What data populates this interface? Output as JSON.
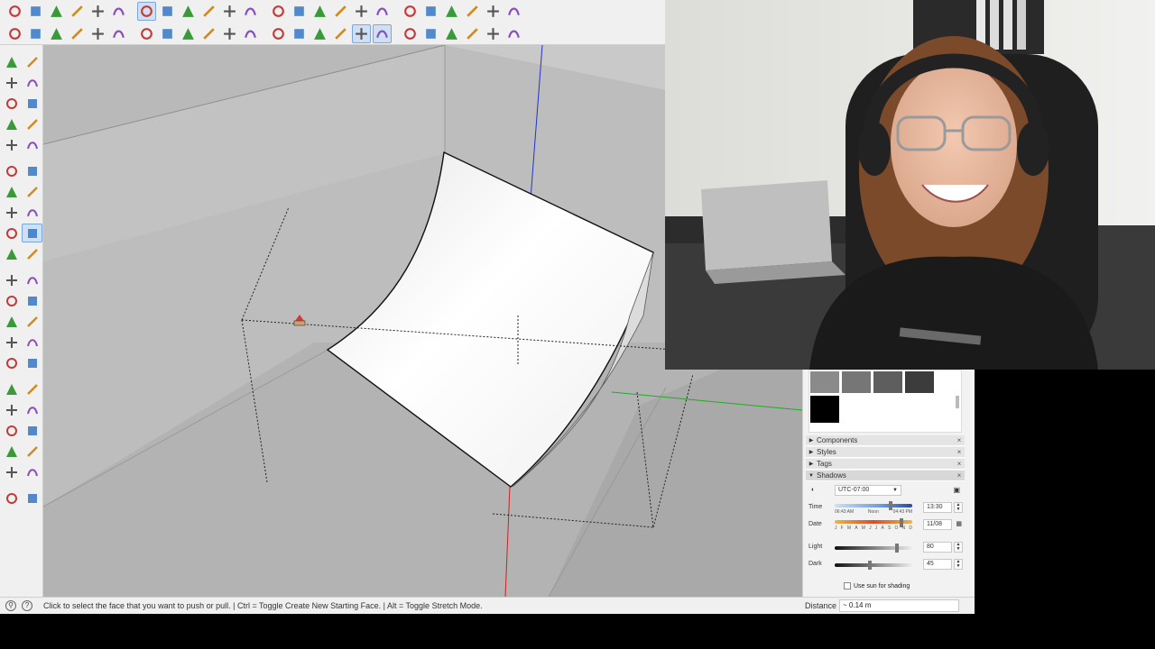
{
  "app": {
    "toolbar_row1_icons": [
      "search-icon",
      "select-icon",
      "eraser-icon",
      "pencil-icon",
      "arc-icon",
      "rectangle-icon",
      "push-pull-icon",
      "follow-me-icon",
      "move-icon",
      "rotate-icon",
      "scale-icon",
      "tape-measure-icon",
      "text-icon",
      "paint-bucket-icon",
      "orbit-icon",
      "zoom-icon",
      "zoom-extents-icon",
      "sandbox-icon",
      "walk-icon",
      "position-camera-icon",
      "look-around-icon",
      "section-plane-icon",
      "display-section-icon",
      "outliner-icon"
    ],
    "toolbar_row2_icons": [
      "component-icon",
      "group-icon",
      "home-icon",
      "warehouse-icon",
      "share-icon",
      "upload-icon",
      "solid-union-icon",
      "solid-subtract-icon",
      "solid-intersect-icon",
      "solid-trim-icon",
      "solid-split-icon",
      "solid-outer-icon",
      "xray-icon",
      "back-edges-icon",
      "wireframe-icon",
      "hidden-line-icon",
      "shaded-icon",
      "textured-icon",
      "iso-view-icon",
      "top-view-icon",
      "front-view-icon",
      "right-view-icon",
      "back-view-icon",
      "left-view-icon"
    ],
    "left_toolbar_icons": [
      "select-icon",
      "orbit-icon",
      "paint-bucket-icon",
      "eraser-icon",
      "tag-icon",
      "eraser-soft-icon",
      "line-icon",
      "freehand-icon",
      "rectangle-icon",
      "rotated-rectangle-icon",
      "circle-icon",
      "polygon-icon",
      "arc-icon",
      "pie-icon",
      "two-point-arc-icon",
      "three-point-arc-icon",
      "move-icon",
      "push-pull-icon",
      "rotate-icon",
      "follow-me-icon",
      "scale-icon",
      "offset-icon",
      "tape-measure-icon",
      "dimension-icon",
      "protractor-icon",
      "text-icon",
      "axes-icon",
      "3d-text-icon",
      "section-plane-icon",
      "paint-icon",
      "pan-icon",
      "zoom-window-icon",
      "zoom-extents-icon",
      "zoom-icon",
      "position-camera-icon",
      "look-around-icon",
      "walk-icon",
      "footprint-icon",
      "sandbox-from-contours-icon",
      "sandbox-from-scratch-icon",
      "smoove-icon",
      "stamp-icon"
    ]
  },
  "tray": {
    "swatch_colors": [
      "#8a8a8a",
      "#767676",
      "#5e5e5e",
      "#3c3c3c",
      "#000000"
    ],
    "sections": [
      {
        "label": "Components",
        "open": false
      },
      {
        "label": "Styles",
        "open": false
      },
      {
        "label": "Tags",
        "open": false
      },
      {
        "label": "Shadows",
        "open": true
      }
    ],
    "shadows": {
      "timezone": "UTC-07:00",
      "time_label": "Time",
      "time_start": "06:43 AM",
      "time_mid": "Noon",
      "time_end": "04:43 PM",
      "time_value": "13:30",
      "date_label": "Date",
      "months": [
        "J",
        "F",
        "M",
        "A",
        "M",
        "J",
        "J",
        "A",
        "S",
        "O",
        "N",
        "D"
      ],
      "date_value": "11/08",
      "light_label": "Light",
      "light_value": "80",
      "light_level": 0.8,
      "dark_label": "Dark",
      "dark_value": "45",
      "dark_level": 0.45,
      "use_sun_label": "Use sun for shading"
    }
  },
  "status": {
    "message": "Click to select the face that you want to push or pull. | Ctrl = Toggle Create New Starting Face. | Alt = Toggle Stretch Mode.",
    "measure_label": "Distance",
    "measure_value": "~ 0.14 m"
  },
  "colors": {
    "toolbar_bg": "#f0f0f0",
    "viewport_bg": "#b9b9b9",
    "active_tool": "#cfe0f5",
    "axis_red": "#cc2222",
    "axis_green": "#22aa22",
    "axis_blue": "#2233cc"
  }
}
